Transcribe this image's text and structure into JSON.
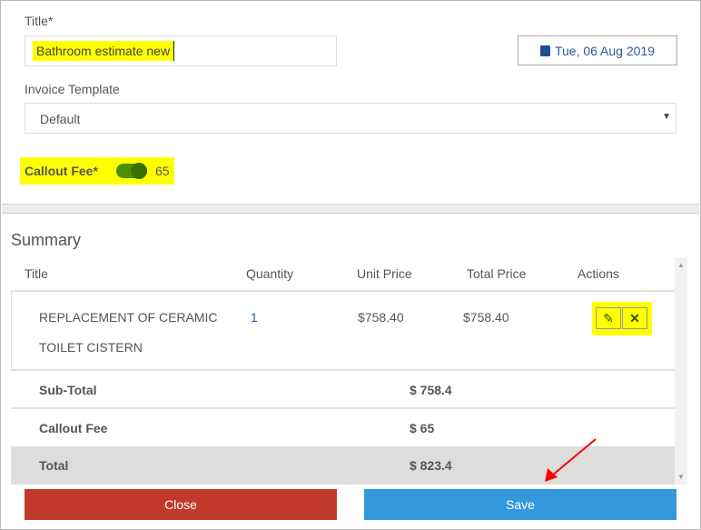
{
  "form": {
    "title_label": "Title*",
    "title_value": "Bathroom estimate new",
    "date_label": "Tue, 06 Aug 2019",
    "template_label": "Invoice Template",
    "template_value": "Default",
    "callout_label": "Callout Fee*",
    "callout_on": true,
    "callout_value": "65"
  },
  "summary": {
    "heading": "Summary",
    "columns": [
      "Title",
      "Quantity",
      "Unit Price",
      "Total Price",
      "Actions"
    ],
    "items": [
      {
        "title_line1": "REPLACEMENT OF CERAMIC",
        "title_line2": "TOILET CISTERN",
        "quantity": "1",
        "unit_price": "$758.40",
        "total_price": "$758.40"
      }
    ],
    "subtotal_label": "Sub-Total",
    "subtotal_value": "$ 758.4",
    "callout_label": "Callout Fee",
    "callout_value": "$ 65",
    "total_label": "Total",
    "total_value": "$ 823.4"
  },
  "buttons": {
    "close": "Close",
    "save": "Save"
  },
  "colors": {
    "close": "#c0392b",
    "save": "#3498db",
    "highlight": "#ffff00",
    "toggle": "#3a7a00",
    "annotation_arrow": "#ff0000"
  }
}
